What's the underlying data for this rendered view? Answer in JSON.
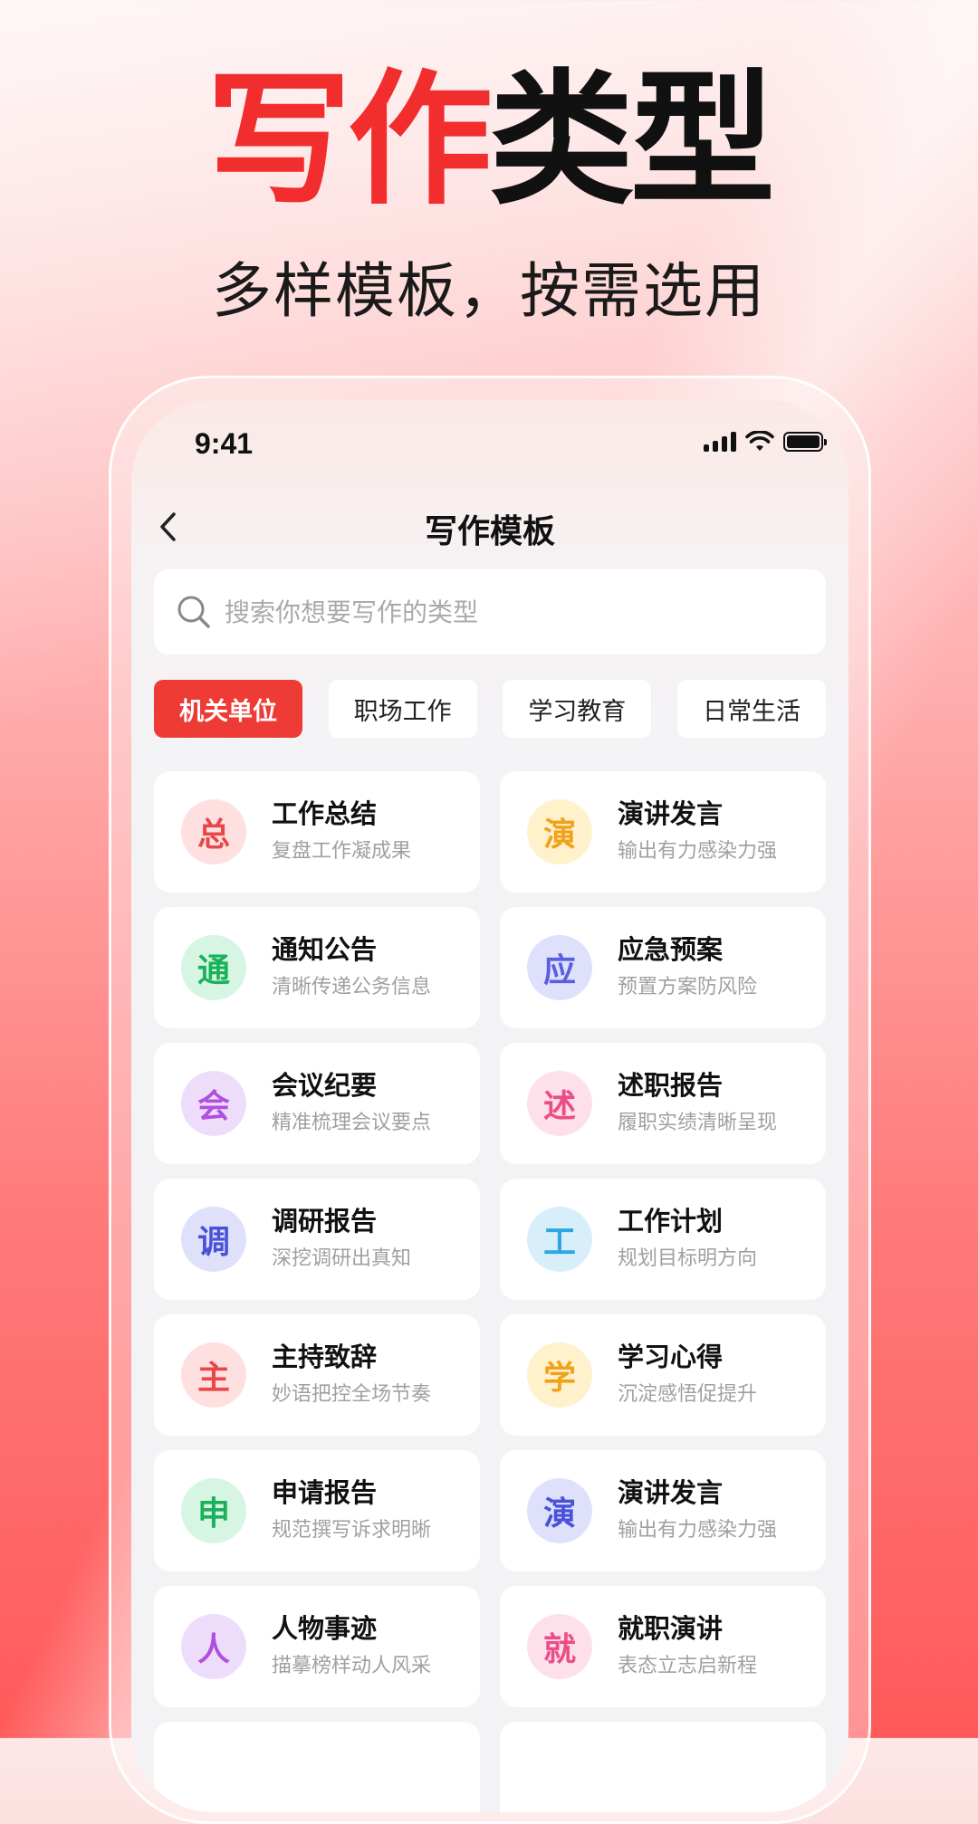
{
  "promo": {
    "title_accent": "写作",
    "title_plain": "类型",
    "subtitle": "多样模板，按需选用"
  },
  "status_bar": {
    "time": "9:41"
  },
  "nav": {
    "title": "写作模板"
  },
  "search": {
    "placeholder": "搜索你想要写作的类型"
  },
  "tabs": [
    {
      "label": "机关单位",
      "active": true
    },
    {
      "label": "职场工作",
      "active": false
    },
    {
      "label": "学习教育",
      "active": false
    },
    {
      "label": "日常生活",
      "active": false
    }
  ],
  "colors": {
    "accent": "#ee3b36"
  },
  "templates": [
    {
      "icon": "总",
      "title": "工作总结",
      "desc": "复盘工作凝成果",
      "fg": "#e8474a",
      "bg": "#ffe0e0"
    },
    {
      "icon": "演",
      "title": "演讲发言",
      "desc": "输出有力感染力强",
      "fg": "#f0a21a",
      "bg": "#fff1cc"
    },
    {
      "icon": "通",
      "title": "通知公告",
      "desc": "清晰传递公务信息",
      "fg": "#19b25a",
      "bg": "#d6f5e2"
    },
    {
      "icon": "应",
      "title": "应急预案",
      "desc": "预置方案防风险",
      "fg": "#5a5ee0",
      "bg": "#dfe0fb"
    },
    {
      "icon": "会",
      "title": "会议纪要",
      "desc": "精准梳理会议要点",
      "fg": "#b150e0",
      "bg": "#eedcfb"
    },
    {
      "icon": "述",
      "title": "述职报告",
      "desc": "履职实绩清晰呈现",
      "fg": "#ec4d86",
      "bg": "#fde0ea"
    },
    {
      "icon": "调",
      "title": "调研报告",
      "desc": "深挖调研出真知",
      "fg": "#4a52d8",
      "bg": "#dfe1fb"
    },
    {
      "icon": "工",
      "title": "工作计划",
      "desc": "规划目标明方向",
      "fg": "#2ea6e0",
      "bg": "#d9eefb"
    },
    {
      "icon": "主",
      "title": "主持致辞",
      "desc": "妙语把控全场节奏",
      "fg": "#e8474a",
      "bg": "#ffe0e0"
    },
    {
      "icon": "学",
      "title": "学习心得",
      "desc": "沉淀感悟促提升",
      "fg": "#f0a21a",
      "bg": "#fff1cc"
    },
    {
      "icon": "申",
      "title": "申请报告",
      "desc": "规范撰写诉求明晰",
      "fg": "#19b25a",
      "bg": "#d6f5e2"
    },
    {
      "icon": "演",
      "title": "演讲发言",
      "desc": "输出有力感染力强",
      "fg": "#4a52d8",
      "bg": "#dfe1fb"
    },
    {
      "icon": "人",
      "title": "人物事迹",
      "desc": "描摹榜样动人风采",
      "fg": "#b150e0",
      "bg": "#eedcfb"
    },
    {
      "icon": "就",
      "title": "就职演讲",
      "desc": "表态立志启新程",
      "fg": "#ec4d86",
      "bg": "#fde0ea"
    }
  ]
}
